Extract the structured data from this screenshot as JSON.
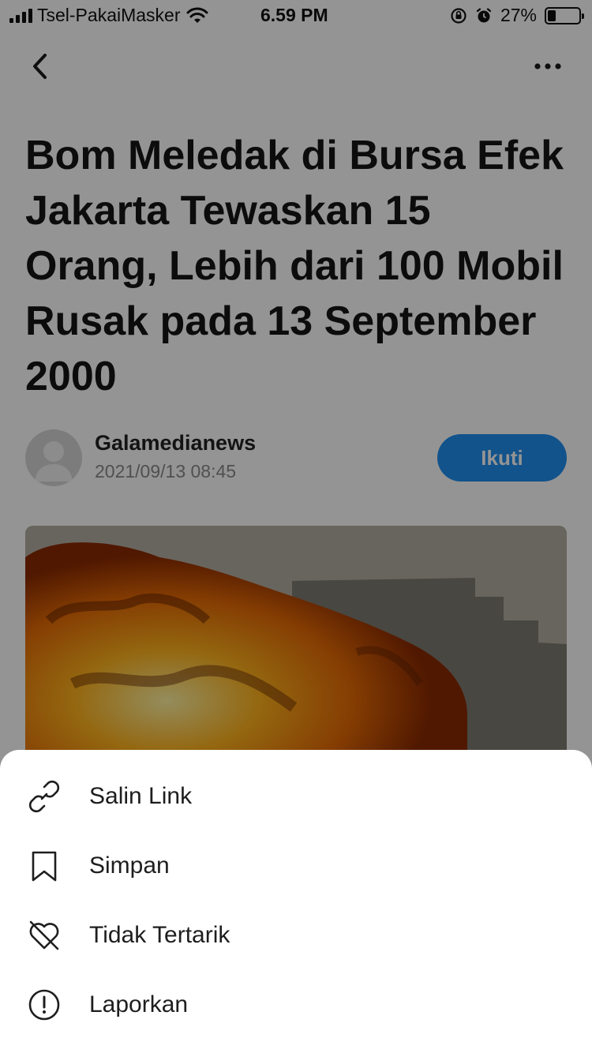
{
  "status_bar": {
    "carrier": "Tsel-PakaiMasker",
    "time": "6.59 PM",
    "battery": "27%",
    "battery_level": 0.27
  },
  "nav": {
    "back_icon": "chevron-left-icon",
    "more_icon": "more-horizontal-icon"
  },
  "article": {
    "title": "Bom Meledak di Bursa Efek Jakarta Tewaskan 15 Orang, Lebih dari 100 Mobil Rusak pada 13 September 2000",
    "author": "Galamedianews",
    "date": "2021/09/13 08:45",
    "follow_label": "Ikuti"
  },
  "sheet": {
    "items": [
      {
        "label": "Salin Link",
        "icon": "link-icon"
      },
      {
        "label": "Simpan",
        "icon": "bookmark-icon"
      },
      {
        "label": "Tidak Tertarik",
        "icon": "heart-off-icon"
      },
      {
        "label": "Laporkan",
        "icon": "alert-circle-icon"
      }
    ]
  },
  "colors": {
    "accent": "#1f8fef",
    "overlay": "rgba(0,0,0,0.42)"
  }
}
